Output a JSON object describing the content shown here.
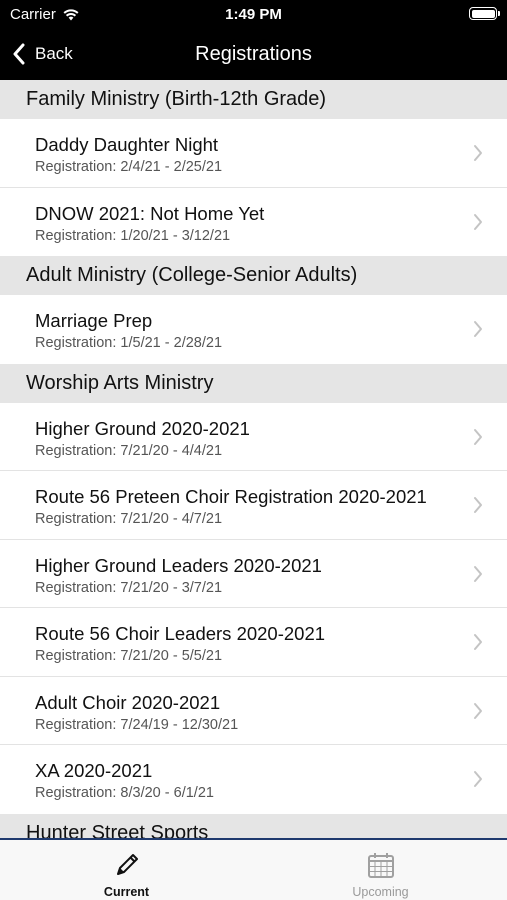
{
  "status": {
    "carrier": "Carrier",
    "time": "1:49 PM"
  },
  "nav": {
    "back_label": "Back",
    "title": "Registrations"
  },
  "sections": [
    {
      "header": "Family Ministry (Birth-12th Grade)",
      "items": [
        {
          "title": "Daddy Daughter Night",
          "subtitle": "Registration: 2/4/21 - 2/25/21"
        },
        {
          "title": "DNOW 2021: Not Home Yet",
          "subtitle": "Registration: 1/20/21 - 3/12/21"
        }
      ]
    },
    {
      "header": "Adult Ministry (College-Senior Adults)",
      "items": [
        {
          "title": "Marriage Prep",
          "subtitle": "Registration: 1/5/21 - 2/28/21"
        }
      ]
    },
    {
      "header": "Worship Arts Ministry",
      "items": [
        {
          "title": "Higher Ground 2020-2021",
          "subtitle": "Registration: 7/21/20 - 4/4/21"
        },
        {
          "title": "Route 56 Preteen Choir Registration 2020-2021",
          "subtitle": "Registration: 7/21/20 - 4/7/21"
        },
        {
          "title": "Higher Ground Leaders 2020-2021",
          "subtitle": "Registration: 7/21/20 - 3/7/21"
        },
        {
          "title": "Route 56 Choir Leaders 2020-2021",
          "subtitle": "Registration: 7/21/20 - 5/5/21"
        },
        {
          "title": "Adult Choir 2020-2021",
          "subtitle": "Registration: 7/24/19 - 12/30/21"
        },
        {
          "title": "XA 2020-2021",
          "subtitle": "Registration: 8/3/20 - 6/1/21"
        }
      ]
    },
    {
      "header": "Hunter Street Sports",
      "items": []
    }
  ],
  "tabs": {
    "current_label": "Current",
    "upcoming_label": "Upcoming"
  },
  "colors": {
    "accent": "#1f3a6e",
    "section_bg": "#e5e5e5",
    "topbar_bg": "#000000"
  }
}
